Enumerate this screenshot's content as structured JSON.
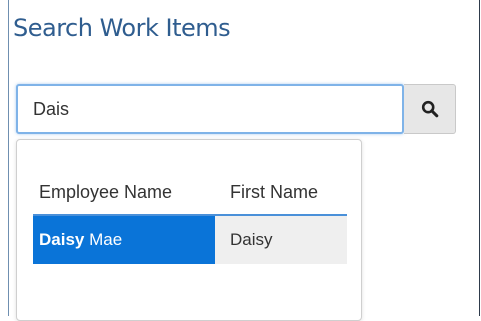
{
  "page": {
    "title": "Search Work Items"
  },
  "search": {
    "value": "Dais",
    "button_icon": "search-icon"
  },
  "results": {
    "columns": [
      "Employee Name",
      "First Name"
    ],
    "rows": [
      {
        "employee_name_match": "Daisy",
        "employee_name_rest": " Mae",
        "first_name": "Daisy",
        "highlighted": true
      }
    ]
  },
  "colors": {
    "title": "#2f5d8f",
    "input_focus_border": "#7fb3e8",
    "selected_row": "#0a74d8",
    "header_underline": "#4a90d9",
    "cell_background": "#efefef"
  }
}
